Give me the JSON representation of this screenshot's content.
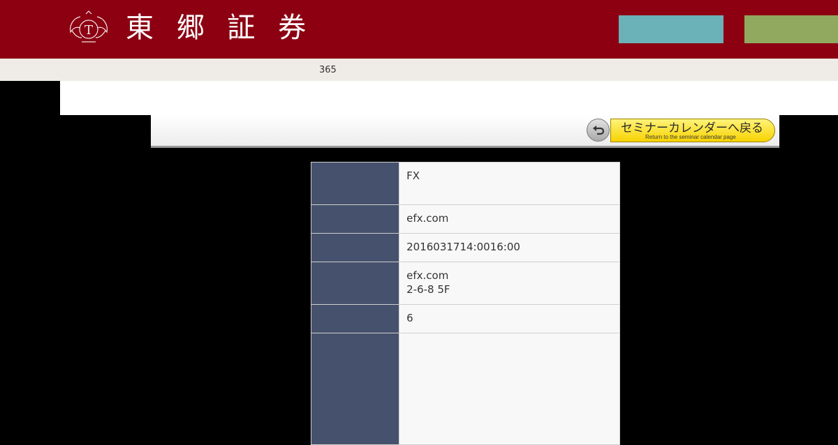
{
  "header": {
    "brand_name": "東 郷 証 券",
    "logo_icon": "crest-emblem-icon",
    "colors": {
      "background": "#8c0012",
      "button_teal": "#6ab2b8",
      "button_green": "#91a95e"
    }
  },
  "subbar": {
    "text": "365"
  },
  "toolbar": {
    "back_button": {
      "label": "セミナーカレンダーへ戻る",
      "sublabel": "Return to the seminar calendar page",
      "icon": "back-arrow-icon"
    }
  },
  "details": {
    "rows": [
      {
        "lines": [
          "FX"
        ]
      },
      {
        "lines": [
          "efx.com"
        ]
      },
      {
        "lines": [
          "2016031714:0016:00"
        ]
      },
      {
        "lines": [
          "efx.com",
          "2-6-8 5F"
        ]
      },
      {
        "lines": [
          "6"
        ]
      },
      {
        "lines": []
      }
    ],
    "colors": {
      "label_cell": "#46516d",
      "value_cell": "#f8f8f8"
    }
  }
}
